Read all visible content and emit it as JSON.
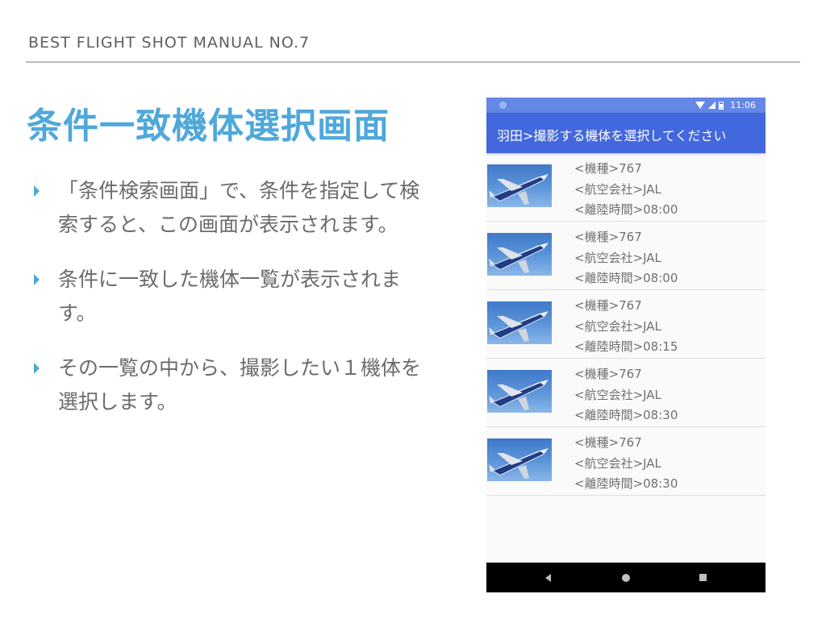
{
  "header": {
    "deck_title": "BEST FLIGHT SHOT MANUAL NO.7"
  },
  "slide": {
    "title": "条件一致機体選択画面",
    "bullets": [
      "「条件検索画面」で、条件を指定して検索すると、この画面が表示されます。",
      "条件に一致した機体一覧が表示されます。",
      "その一覧の中から、撮影したい１機体を選択します。"
    ]
  },
  "phone": {
    "status_time": "11:06",
    "appbar_title": "羽田>撮影する機体を選択してください",
    "flights": [
      {
        "type": "<機種>767",
        "airline": "<航空会社>JAL",
        "time": "<離陸時間>08:00",
        "thumbnail": "airplane-photo"
      },
      {
        "type": "<機種>767",
        "airline": "<航空会社>JAL",
        "time": "<離陸時間>08:00",
        "thumbnail": "airplane-photo"
      },
      {
        "type": "<機種>767",
        "airline": "<航空会社>JAL",
        "time": "<離陸時間>08:15",
        "thumbnail": "airplane-photo"
      },
      {
        "type": "<機種>767",
        "airline": "<航空会社>JAL",
        "time": "<離陸時間>08:30",
        "thumbnail": "airplane-photo"
      },
      {
        "type": "<機種>767",
        "airline": "<航空会社>JAL",
        "time": "<離陸時間>08:30",
        "thumbnail": "airplane-photo"
      }
    ],
    "nav_icons": [
      "back-icon",
      "home-icon",
      "recent-apps-icon"
    ]
  },
  "colors": {
    "title_accent": "#4fa8da",
    "appbar": "#4367dc",
    "statusbar": "#6587e6"
  }
}
